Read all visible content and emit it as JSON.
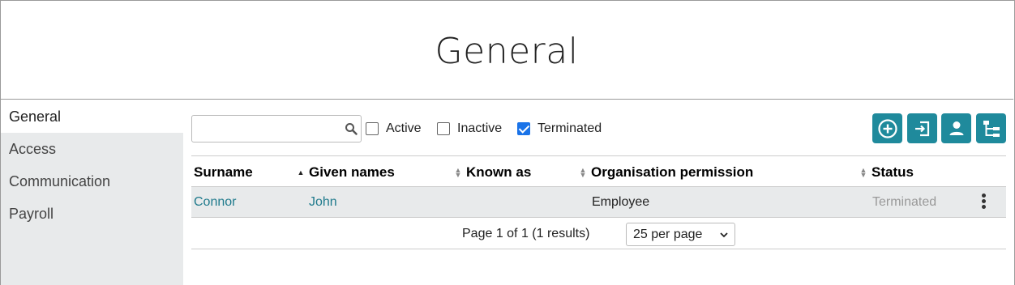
{
  "page": {
    "title": "General"
  },
  "sidebar": {
    "items": [
      {
        "label": "General",
        "active": true
      },
      {
        "label": "Access"
      },
      {
        "label": "Communication"
      },
      {
        "label": "Payroll"
      }
    ]
  },
  "search": {
    "value": "",
    "placeholder": ""
  },
  "filters": [
    {
      "label": "Active",
      "checked": false
    },
    {
      "label": "Inactive",
      "checked": false
    },
    {
      "label": "Terminated",
      "checked": true
    }
  ],
  "toolbar": {
    "icons": [
      "add-circle-icon",
      "import-icon",
      "person-icon",
      "hierarchy-icon"
    ],
    "accent_color": "#1f8a9c"
  },
  "table": {
    "columns": [
      {
        "label": "Surname",
        "sort": "none"
      },
      {
        "label": "Given names",
        "sort": "asc"
      },
      {
        "label": "Known as",
        "sort": "both"
      },
      {
        "label": "Organisation permission",
        "sort": "both"
      },
      {
        "label": "Status",
        "sort": "both"
      }
    ],
    "rows": [
      {
        "surname": "Connor",
        "given_names": "John",
        "known_as": "",
        "organisation_permission": "Employee",
        "status": "Terminated"
      }
    ]
  },
  "pagination": {
    "summary": "Page 1 of 1 (1 results)",
    "per_page": "25 per page"
  }
}
